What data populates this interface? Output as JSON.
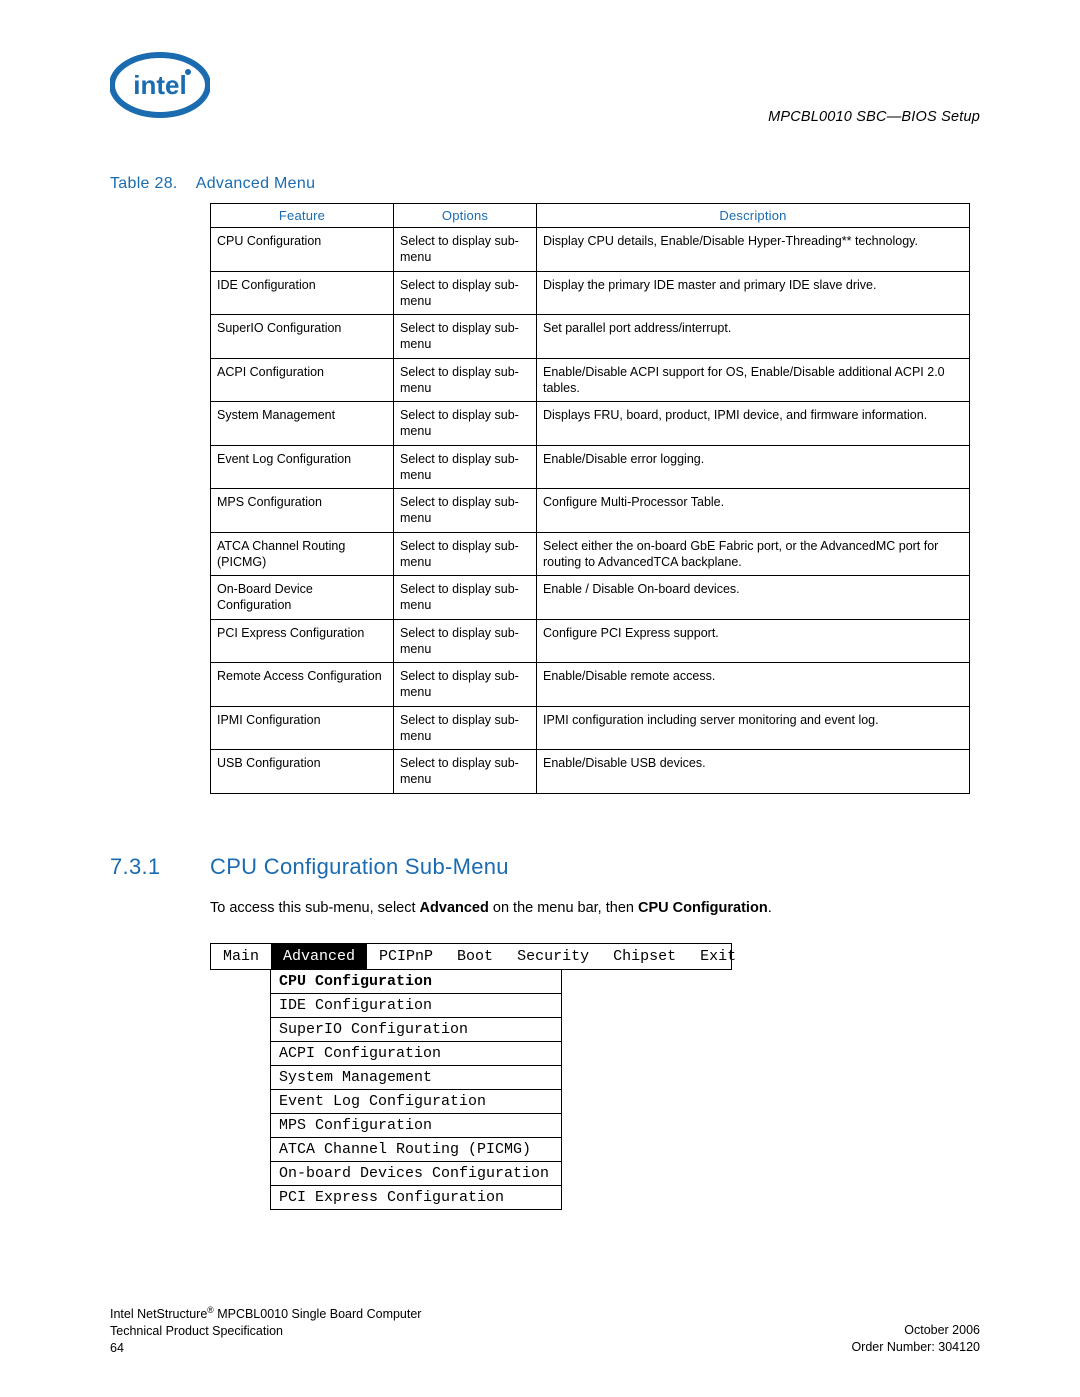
{
  "header": {
    "doc_title": "MPCBL0010 SBC—BIOS Setup"
  },
  "table": {
    "caption_prefix": "Table 28.",
    "caption_title": "Advanced Menu",
    "headers": {
      "c1": "Feature",
      "c2": "Options",
      "c3": "Description"
    },
    "rows": [
      {
        "feature": "CPU Configuration",
        "options": "Select to display sub-menu",
        "desc": "Display CPU details, Enable/Disable Hyper-Threading** technology."
      },
      {
        "feature": "IDE Configuration",
        "options": "Select to display sub-menu",
        "desc": "Display the primary IDE master and primary IDE slave drive."
      },
      {
        "feature": "SuperIO Configuration",
        "options": "Select to display sub-menu",
        "desc": "Set parallel port address/interrupt."
      },
      {
        "feature": "ACPI Configuration",
        "options": "Select to display sub-menu",
        "desc": "Enable/Disable ACPI support for OS, Enable/Disable additional ACPI 2.0 tables."
      },
      {
        "feature": "System Management",
        "options": "Select to display sub-menu",
        "desc": "Displays FRU, board, product, IPMI device, and firmware information."
      },
      {
        "feature": "Event Log Configuration",
        "options": "Select to display sub-menu",
        "desc": "Enable/Disable error logging."
      },
      {
        "feature": "MPS Configuration",
        "options": "Select to display sub-menu",
        "desc": "Configure Multi-Processor Table."
      },
      {
        "feature": "ATCA Channel Routing (PICMG)",
        "options": "Select to display sub-menu",
        "desc": "Select either the on-board GbE Fabric port, or the AdvancedMC port for routing to AdvancedTCA backplane."
      },
      {
        "feature": "On-Board Device Configuration",
        "options": "Select to display sub-menu",
        "desc": "Enable / Disable On-board devices."
      },
      {
        "feature": "PCI Express Configuration",
        "options": "Select to display sub-menu",
        "desc": "Configure PCI Express support."
      },
      {
        "feature": "Remote Access Configuration",
        "options": "Select to display sub-menu",
        "desc": "Enable/Disable remote access."
      },
      {
        "feature": "IPMI Configuration",
        "options": "Select to display sub-menu",
        "desc": "IPMI configuration including server monitoring and event log."
      },
      {
        "feature": "USB Configuration",
        "options": "Select to display sub-menu",
        "desc": "Enable/Disable USB devices."
      }
    ]
  },
  "section": {
    "number": "7.3.1",
    "title": "CPU Configuration Sub-Menu",
    "intro_pre": "To access this sub-menu, select ",
    "intro_bold1": "Advanced",
    "intro_mid": " on the menu bar, then ",
    "intro_bold2": "CPU Configuration",
    "intro_end": "."
  },
  "menu": {
    "tabs": [
      "Main",
      "Advanced",
      "PCIPnP",
      "Boot",
      "Security",
      "Chipset",
      "Exit"
    ],
    "active_tab": "Advanced",
    "items": [
      "CPU Configuration",
      "IDE Configuration",
      "SuperIO Configuration",
      "ACPI Configuration",
      "System Management",
      "Event Log Configuration",
      "MPS Configuration",
      "ATCA Channel Routing (PICMG)",
      "On-board Devices Configuration",
      "PCI Express Configuration"
    ]
  },
  "footer": {
    "line1": "Intel NetStructure® MPCBL0010 Single Board Computer",
    "line2": "Technical Product Specification",
    "page": "64",
    "date": "October 2006",
    "order": "Order Number: 304120"
  }
}
